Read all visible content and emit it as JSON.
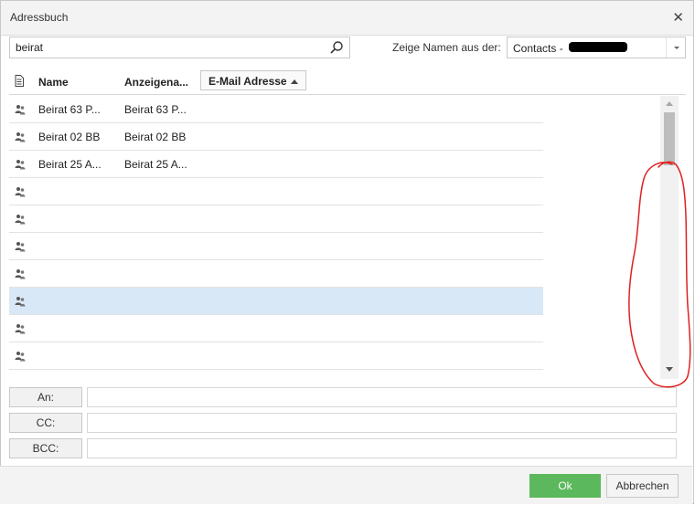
{
  "dialog": {
    "title": "Adressbuch",
    "close_symbol": "✕"
  },
  "search": {
    "value": "beirat",
    "placeholder": ""
  },
  "source": {
    "label": "Zeige Namen aus der:",
    "selected": "Contacts -"
  },
  "columns": {
    "name": "Name",
    "display_name": "Anzeigena...",
    "email": "E-Mail Adresse"
  },
  "rows": [
    {
      "name": "Beirat 63 P...",
      "display": "Beirat 63 P..."
    },
    {
      "name": "Beirat 02 BB",
      "display": "Beirat 02 BB"
    },
    {
      "name": "Beirat 25 A...",
      "display": "Beirat 25 A..."
    },
    {
      "name": "",
      "display": ""
    },
    {
      "name": "",
      "display": ""
    },
    {
      "name": "",
      "display": ""
    },
    {
      "name": "",
      "display": ""
    },
    {
      "name": "",
      "display": ""
    },
    {
      "name": "",
      "display": ""
    },
    {
      "name": "",
      "display": ""
    },
    {
      "name": "",
      "display": ""
    }
  ],
  "recipients": {
    "to_label": "An:",
    "cc_label": "CC:",
    "bcc_label": "BCC:"
  },
  "buttons": {
    "ok": "Ok",
    "cancel": "Abbrechen"
  },
  "colors": {
    "ok_green": "#5cb85c",
    "selection": "#d9e8f6",
    "annotation_red": "#e02020"
  },
  "icons": [
    "search-icon",
    "document-icon",
    "person-group-icon",
    "close-icon",
    "sort-ascending-icon"
  ]
}
